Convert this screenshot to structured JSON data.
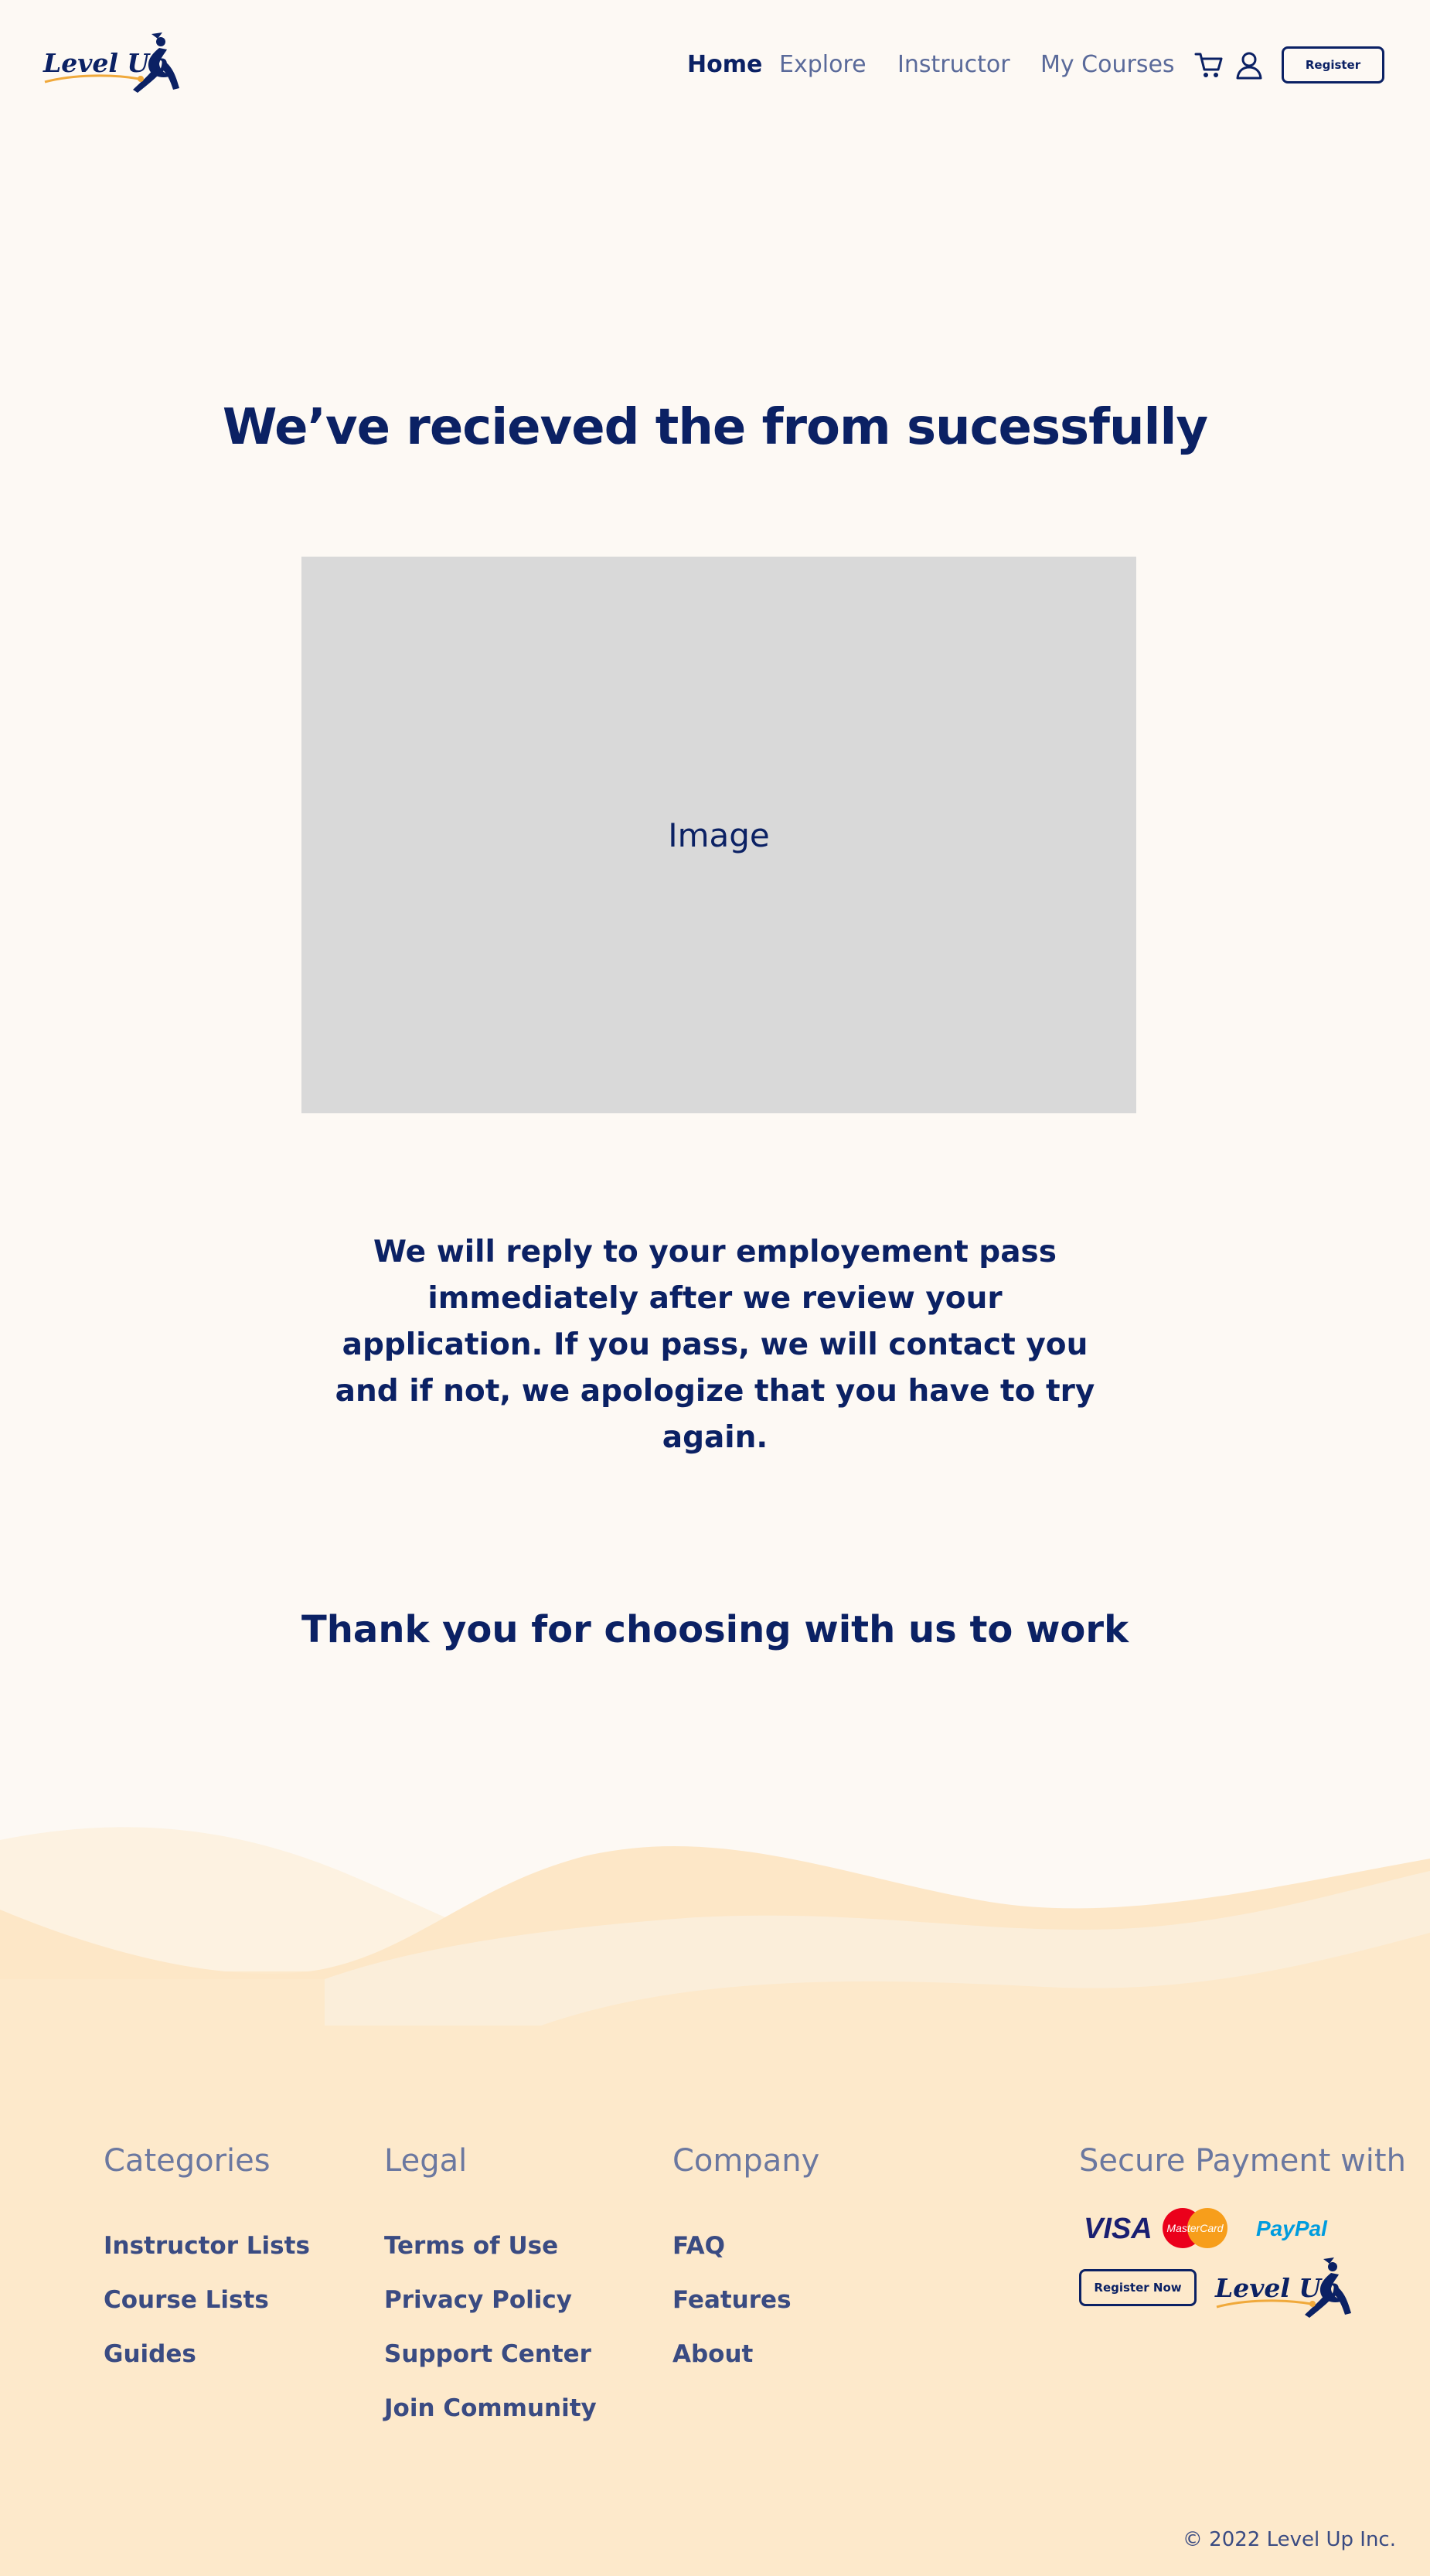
{
  "brand": {
    "name": "Level Up",
    "colors": {
      "primary": "#0b2164",
      "accent": "#f0a93b",
      "background": "#fdf9f4",
      "footer": "#fde9cb"
    }
  },
  "nav": {
    "links": [
      {
        "label": "Home",
        "active": true
      },
      {
        "label": "Explore",
        "active": false
      },
      {
        "label": "Instructor",
        "active": false
      },
      {
        "label": "My Courses",
        "active": false
      }
    ],
    "icons": [
      "cart-icon",
      "user-icon"
    ],
    "register_label": "Register"
  },
  "main": {
    "headline": "We’ve recieved the from sucessfully",
    "image_placeholder": "Image",
    "message": "We will reply to your employement pass immediately after we review your application. If you pass, we will contact you and if not, we apologize that you have to try again.",
    "thanks": "Thank you for choosing with us to work"
  },
  "footer": {
    "columns": [
      {
        "heading": "Categories",
        "links": [
          "Instructor Lists",
          "Course Lists",
          "Guides"
        ]
      },
      {
        "heading": "Legal",
        "links": [
          "Terms of Use",
          "Privacy Policy",
          "Support Center",
          "Join Community"
        ]
      },
      {
        "heading": "Company",
        "links": [
          "FAQ",
          "Features",
          "About"
        ]
      }
    ],
    "payment": {
      "heading": "Secure Payment with",
      "methods": [
        "VISA",
        "MasterCard",
        "PayPal"
      ],
      "button_label": "Register Now"
    },
    "copyright": "© 2022 Level Up Inc."
  }
}
